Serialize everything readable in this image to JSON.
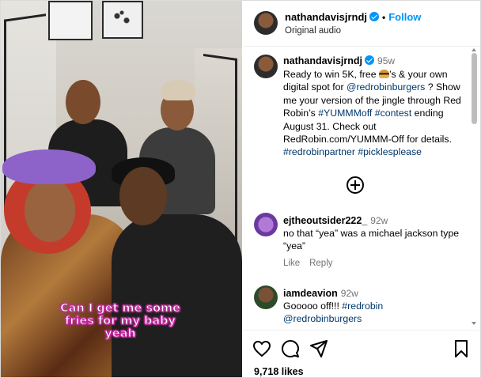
{
  "media": {
    "caption_lines": [
      "Can I get me some",
      "fries for my baby",
      "yeah"
    ]
  },
  "header": {
    "username": "nathandavisjrndj",
    "separator": "•",
    "follow_label": "Follow",
    "audio_label": "Original audio"
  },
  "post": {
    "username": "nathandavisjrndj",
    "age": "95w",
    "text_before_emoji": "Ready to win 5K, free ",
    "emoji": "burger-emoji",
    "text_after_emoji": "’s & your own digital spot for ",
    "mention": "@redrobinburgers",
    "text_2": " ? Show me your version of the jingle through Red Robin’s ",
    "hashtag_1": "#YUMMMoff",
    "space": " ",
    "hashtag_2": "#contest",
    "text_3": " ending August 31. Check out RedRobin.com/YUMMM-Off for details. ",
    "hashtag_3": "#redrobinpartner",
    "hashtag_4": "#picklesplease"
  },
  "comments": [
    {
      "username": "ejtheoutsider222_",
      "age": "92w",
      "text": "no that “yea” was a michael jackson type “yea”",
      "like_label": "Like",
      "reply_label": "Reply"
    },
    {
      "username": "iamdeavion",
      "age": "92w",
      "text": "Gooooo off!!! ",
      "hashtag": "#redrobin",
      "mention": "@redrobinburgers"
    }
  ],
  "footer": {
    "likes": "9,718 likes",
    "icons": [
      "heart-icon",
      "comment-icon",
      "share-icon",
      "bookmark-icon"
    ]
  },
  "colors": {
    "accent": "#0095f6",
    "link": "#00376b",
    "muted": "#737373"
  }
}
